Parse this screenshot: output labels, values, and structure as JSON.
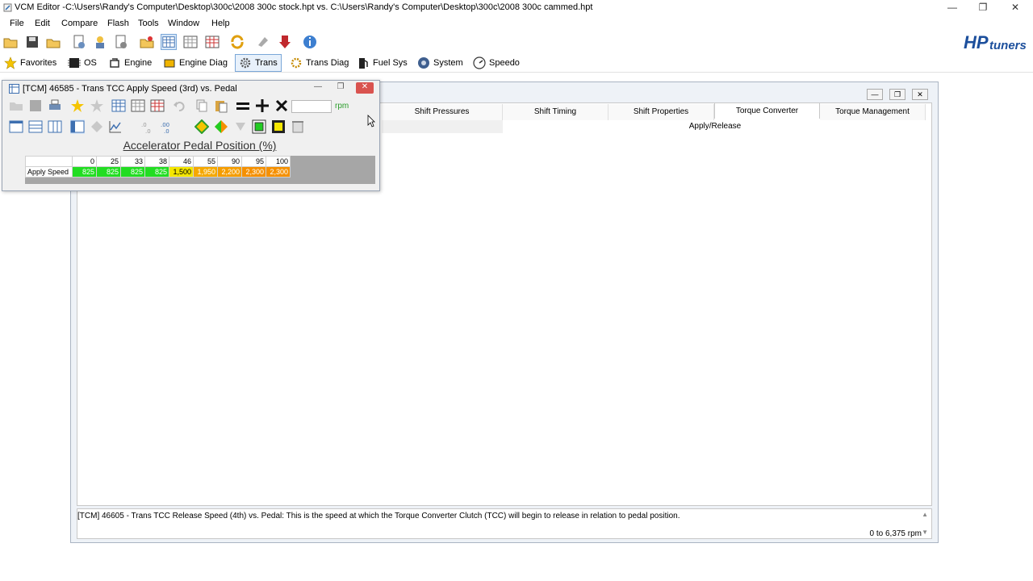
{
  "window": {
    "title": "VCM Editor -C:\\Users\\Randy's Computer\\Desktop\\300c\\2008 300c stock.hpt vs. C:\\Users\\Randy's Computer\\Desktop\\300c\\2008 300c cammed.hpt",
    "minimize": "—",
    "restore": "❐",
    "close": "✕"
  },
  "menu": {
    "items": [
      "File",
      "Edit",
      "Compare",
      "Flash",
      "Tools",
      "Window",
      "Help"
    ]
  },
  "categories": [
    {
      "label": "Favorites",
      "icon": "star-icon"
    },
    {
      "label": "OS",
      "icon": "chip-icon"
    },
    {
      "label": "Engine",
      "icon": "engine-icon"
    },
    {
      "label": "Engine Diag",
      "icon": "engine-diag-icon"
    },
    {
      "label": "Trans",
      "icon": "gear-icon"
    },
    {
      "label": "Trans Diag",
      "icon": "gear-diag-icon"
    },
    {
      "label": "Fuel Sys",
      "icon": "fuel-pump-icon"
    },
    {
      "label": "System",
      "icon": "system-icon"
    },
    {
      "label": "Speedo",
      "icon": "speedometer-icon"
    }
  ],
  "logo": {
    "text_hp": "HP",
    "text_tuners": "tuners"
  },
  "editor": {
    "tabs": [
      "Shift Pressures",
      "Shift Timing",
      "Shift Properties",
      "Torque Converter",
      "Torque Management"
    ],
    "active_tab": "Torque Converter",
    "subtab": "Apply/Release",
    "info": {
      "description": "[TCM] 46605 - Trans TCC Release Speed (4th) vs. Pedal: This is the speed at which the Torque Converter Clutch (TCC) will begin to release in relation to pedal position.",
      "range": "0 to 6,375 rpm"
    }
  },
  "table_window": {
    "title": "[TCM] 46585 - Trans TCC Apply Speed (3rd) vs. Pedal",
    "unit": "rpm",
    "unit_value": "",
    "axis_title": "Accelerator Pedal Position (%)",
    "row_label": "Apply Speed",
    "columns": [
      "0",
      "25",
      "33",
      "38",
      "46",
      "55",
      "90",
      "95",
      "100"
    ],
    "values": [
      "825",
      "825",
      "825",
      "825",
      "1,500",
      "1,950",
      "2,200",
      "2,300",
      "2,300"
    ],
    "cell_colors": [
      "#22dd22",
      "#22dd22",
      "#22dd22",
      "#22dd22",
      "#f4e600",
      "#f5a800",
      "#f59d00",
      "#f59000",
      "#f59000"
    ]
  }
}
